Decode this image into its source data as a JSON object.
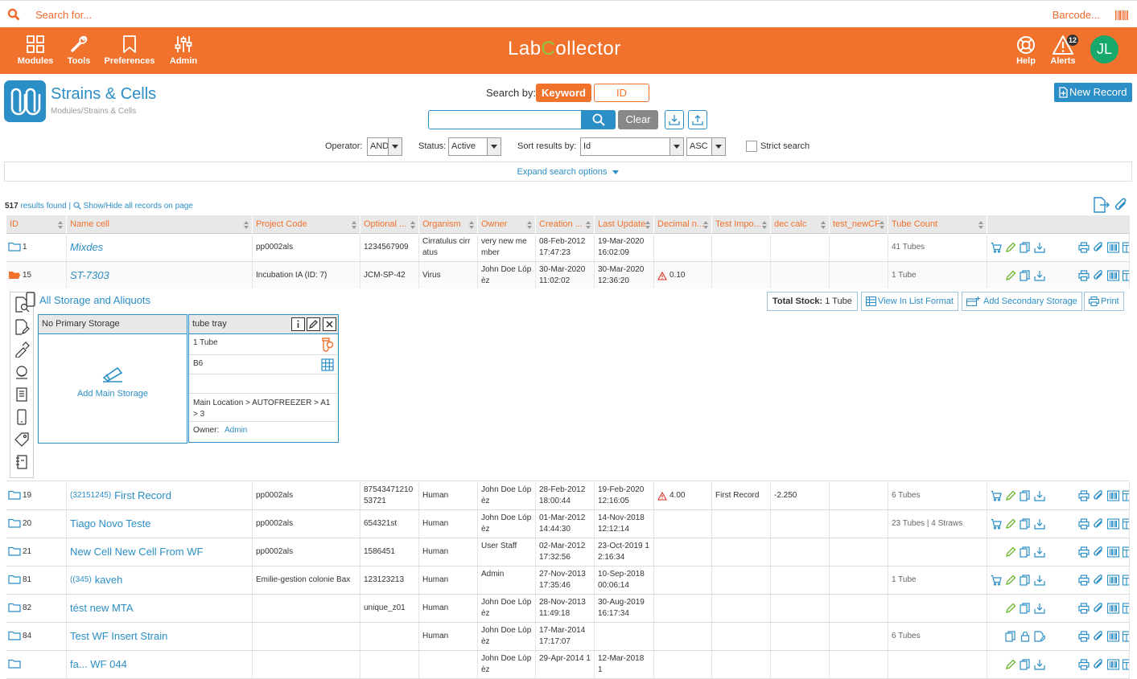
{
  "topbar": {
    "search_placeholder": "Search for...",
    "barcode_label": "Barcode..."
  },
  "nav": {
    "items": [
      {
        "label": "Modules",
        "icon": "grid-icon"
      },
      {
        "label": "Tools",
        "icon": "wrench-icon"
      },
      {
        "label": "Preferences",
        "icon": "bookmark-icon"
      },
      {
        "label": "Admin",
        "icon": "sliders-icon"
      }
    ],
    "logo_left": "Lab",
    "logo_c": "C",
    "logo_right": "ollector",
    "help_label": "Help",
    "alerts_label": "Alerts",
    "alerts_count": "12",
    "avatar_initials": "JL",
    "bar_color": "#f0722c"
  },
  "module": {
    "title": "Strains & Cells",
    "breadcrumb": "Modules/Strains & Cells",
    "new_record_label": "New Record"
  },
  "search": {
    "search_by_label": "Search by:",
    "keyword_tab": "Keyword",
    "id_tab": "ID",
    "clear_label": "Clear",
    "operator_label": "Operator:",
    "operator_value": "AND",
    "status_label": "Status:",
    "status_value": "Active",
    "sort_label": "Sort results by:",
    "sort_value": "Id",
    "sort_dir": "ASC",
    "strict_label": "Strict search",
    "expand_label": "Expand search options"
  },
  "results": {
    "count": "517",
    "count_suffix": "results found |",
    "showhide_label": "Show/Hide all records on page"
  },
  "columns": [
    "ID",
    "Name cell",
    "Project Code",
    "Optional ...",
    "Organism",
    "Owner",
    "Creation ...",
    "Last Update",
    "Decimal n...",
    "Test Impo...",
    "dec calc",
    "test_newCF",
    "Tube Count"
  ],
  "rows": [
    {
      "id": "1",
      "prefix": "",
      "name": "Mixdes",
      "italic": true,
      "project": "pp0002als",
      "optional": "1234567909",
      "organism": "Cirratulus cirratus",
      "owner": "very new member",
      "created": "08-Feb-2012 17:47:23",
      "updated": "19-Mar-2020 16:02:09",
      "decimal": "",
      "warn": false,
      "test": "",
      "dec_calc": "",
      "newcf": "",
      "tubes": "41 Tubes",
      "cart": true,
      "lock": false
    },
    {
      "id": "15",
      "prefix": "",
      "name": "ST-7303",
      "italic": true,
      "project": "Incubation IA (ID: 7)",
      "optional": "JCM-SP-42",
      "organism": "Virus",
      "owner": "John Doe Lópèz",
      "created": "30-Mar-2020 11:02:02",
      "updated": "30-Mar-2020 12:36:20",
      "decimal": "0.10",
      "warn": true,
      "test": "",
      "dec_calc": "",
      "newcf": "",
      "tubes": "1 Tube",
      "cart": false,
      "lock": false
    },
    {
      "id": "19",
      "prefix": "(32151245)",
      "name": "First Record",
      "italic": false,
      "project": "pp0002als",
      "optional": "8754347121053721",
      "organism": "Human",
      "owner": "John Doe Lópèz",
      "created": "28-Feb-2012 18:00:44",
      "updated": "19-Feb-2020 12:16:05",
      "decimal": "4.00",
      "warn": true,
      "test": "First Record",
      "dec_calc": "-2.250",
      "newcf": "",
      "tubes": "6 Tubes",
      "cart": true,
      "lock": false
    },
    {
      "id": "20",
      "prefix": "",
      "name": "Tiago Novo Teste",
      "italic": false,
      "project": "pp0002als",
      "optional": "654321st",
      "organism": "Human",
      "owner": "John Doe Lópèz",
      "created": "01-Mar-2012 14:44:30",
      "updated": "14-Nov-2018 12:12:14",
      "decimal": "",
      "warn": false,
      "test": "",
      "dec_calc": "",
      "newcf": "",
      "tubes": "23 Tubes | 4 Straws",
      "cart": true,
      "lock": false
    },
    {
      "id": "21",
      "prefix": "",
      "name": "New Cell New Cell From WF",
      "italic": false,
      "project": "pp0002als",
      "optional": "1586451",
      "organism": "Human",
      "owner": "User Staff",
      "created": "02-Mar-2012 17:32:56",
      "updated": "23-Oct-2019 12:16:34",
      "decimal": "",
      "warn": false,
      "test": "",
      "dec_calc": "",
      "newcf": "",
      "tubes": "",
      "cart": false,
      "lock": false
    },
    {
      "id": "81",
      "prefix": "((345)",
      "name": "kaveh",
      "italic": false,
      "project": "Emilie-gestion colonie Bax",
      "optional": "123123213",
      "organism": "Human",
      "owner": "Admin",
      "created": "27-Nov-2013 17:35:46",
      "updated": "10-Sep-2018 00:06:14",
      "decimal": "",
      "warn": false,
      "test": "",
      "dec_calc": "",
      "newcf": "",
      "tubes": "1 Tube",
      "cart": true,
      "lock": false
    },
    {
      "id": "82",
      "prefix": "",
      "name": "tést new MTA",
      "italic": false,
      "project": "",
      "optional": "unique_z01",
      "organism": "Human",
      "owner": "John Doe Lópèz",
      "created": "28-Nov-2013 11:49:18",
      "updated": "30-Aug-2019 16:17:34",
      "decimal": "",
      "warn": false,
      "test": "",
      "dec_calc": "",
      "newcf": "",
      "tubes": "",
      "cart": false,
      "lock": false
    },
    {
      "id": "84",
      "prefix": "",
      "name": "Test WF Insert Strain",
      "italic": false,
      "project": "",
      "optional": "",
      "organism": "Human",
      "owner": "John Doe Lópèz",
      "created": "17-Mar-2014 17:17:07",
      "updated": "",
      "decimal": "",
      "warn": false,
      "test": "",
      "dec_calc": "",
      "newcf": "",
      "tubes": "6 Tubes",
      "cart": false,
      "lock": true
    },
    {
      "id": "",
      "prefix": "",
      "name": "fa... WF 044",
      "italic": false,
      "project": "",
      "optional": "",
      "organism": "",
      "owner": "John Doe Lópèz",
      "created": "29-Apr-2014 1",
      "updated": "12-Mar-2018 1",
      "decimal": "",
      "warn": false,
      "test": "",
      "dec_calc": "",
      "newcf": "",
      "tubes": "",
      "cart": false,
      "lock": false
    }
  ],
  "detail": {
    "all_storage_label": "All Storage and Aliquots",
    "primary_label": "No Primary Storage",
    "add_main_label": "Add Main Storage",
    "tray_title": "tube tray",
    "tray_qty": "1 Tube",
    "tray_pos": "B6",
    "tray_location": "Main Location > AUTOFREEZER > A1 > 3",
    "owner_label": "Owner:",
    "owner_value": "Admin",
    "total_stock_label": "Total Stock:",
    "total_stock_value": "1 Tube",
    "list_format_label": "View In List Format",
    "add_secondary_label": "Add Secondary Storage",
    "print_label": "Print"
  }
}
